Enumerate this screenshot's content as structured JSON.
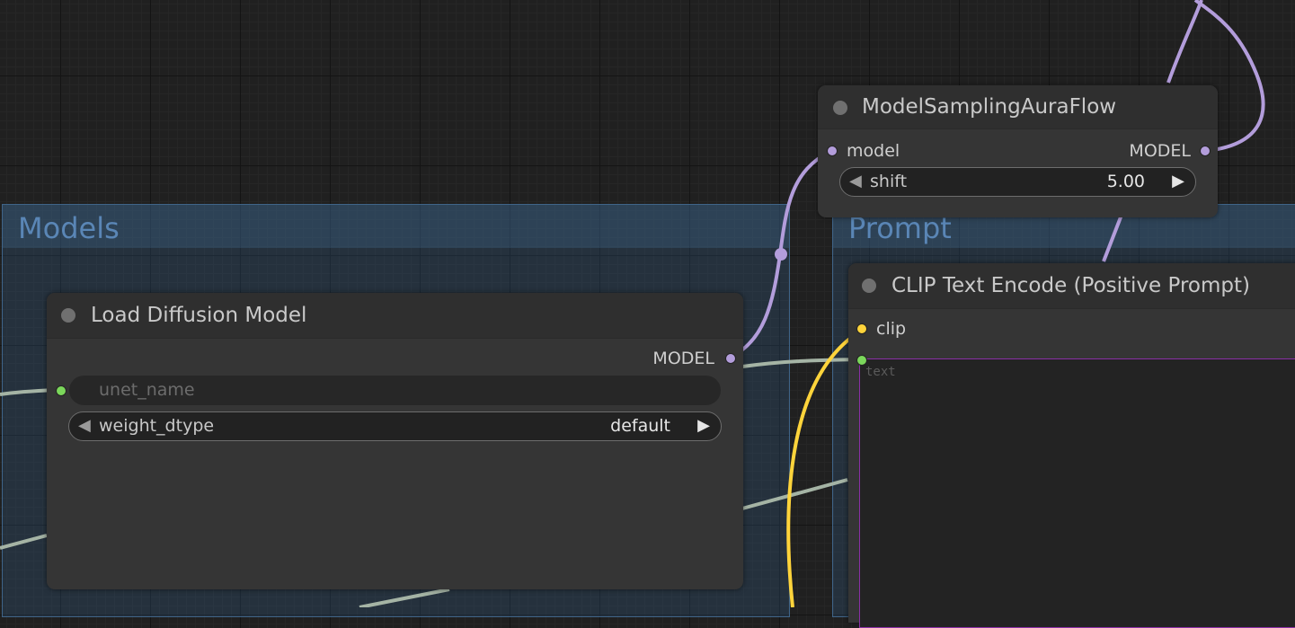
{
  "groups": {
    "models": {
      "title": "Models"
    },
    "prompt": {
      "title": "Prompt"
    }
  },
  "nodes": {
    "model_sampling": {
      "title": "ModelSamplingAuraFlow",
      "input_label": "model",
      "output_label": "MODEL",
      "widget_label": "shift",
      "widget_value": "5.00"
    },
    "load_diffusion": {
      "title": "Load Diffusion Model",
      "output_label": "MODEL",
      "unet_placeholder": "unet_name",
      "weight_label": "weight_dtype",
      "weight_value": "default"
    },
    "clip_text_encode": {
      "title": "CLIP Text Encode (Positive Prompt)",
      "input_label": "clip",
      "text_placeholder": "text"
    }
  },
  "icons": {
    "arrow_left": "◀",
    "arrow_right": "▶"
  },
  "colors": {
    "model_link": "#b39ddb",
    "clip_link": "#ffd43b",
    "string_link": "#a5b4a5",
    "string_slot": "#7bd75b",
    "selection": "#8a2fa6"
  }
}
